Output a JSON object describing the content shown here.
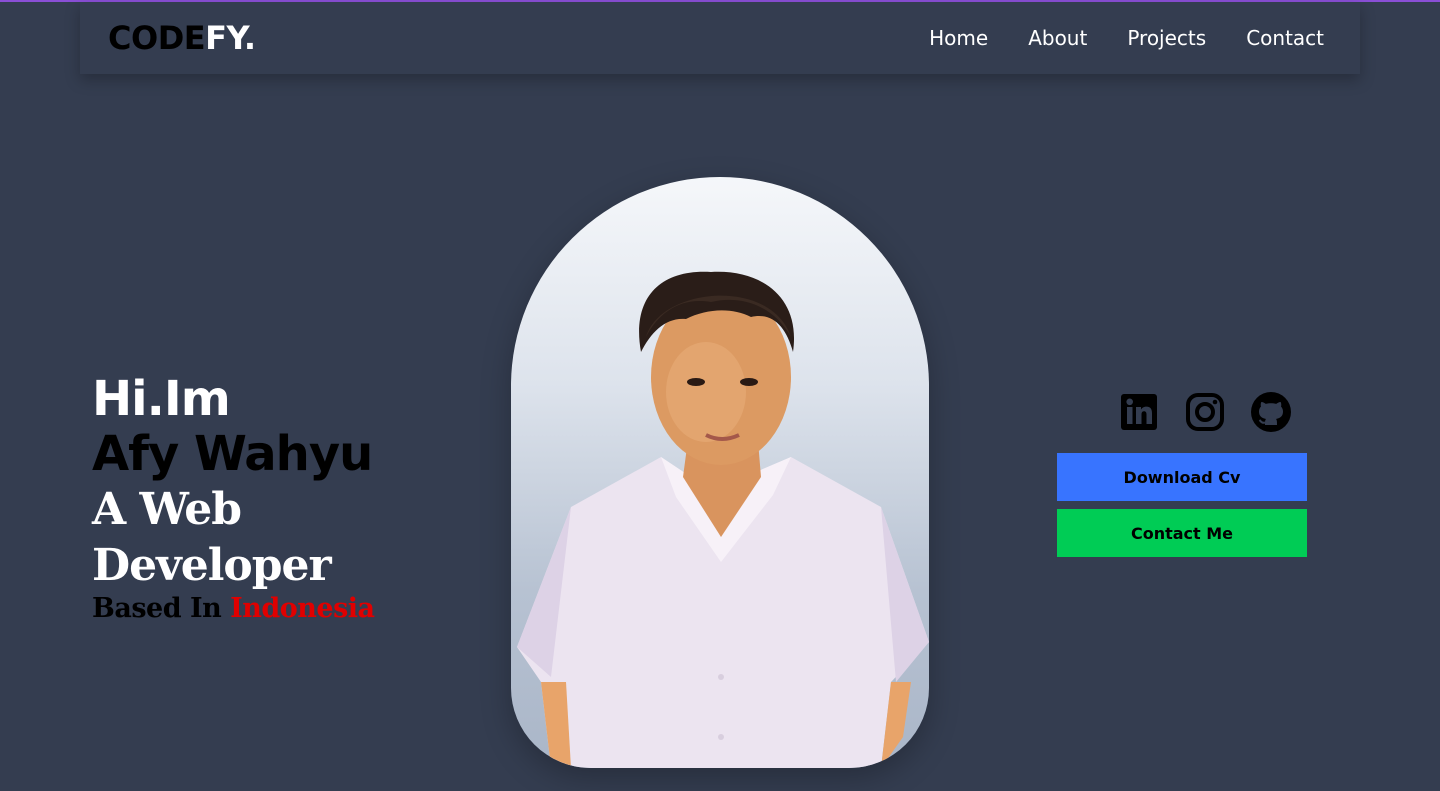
{
  "brand": {
    "logo_dark": "CODE",
    "logo_light": "FY."
  },
  "nav": {
    "items": [
      {
        "label": "Home"
      },
      {
        "label": "About"
      },
      {
        "label": "Projects"
      },
      {
        "label": "Contact"
      }
    ]
  },
  "hero": {
    "greeting": "Hi.Im",
    "name": "Afy Wahyu",
    "role": "A Web Developer",
    "based_prefix": "Based In",
    "based_country": "Indonesia"
  },
  "socials": [
    {
      "icon": "linkedin-icon"
    },
    {
      "icon": "instagram-icon"
    },
    {
      "icon": "github-icon"
    }
  ],
  "buttons": {
    "download_cv": "Download Cv",
    "contact_me": "Contact Me"
  },
  "colors": {
    "background": "#343d50",
    "accent_line": "#8a4fd6",
    "download_button": "#3874ff",
    "contact_button": "#00cc55",
    "country_highlight": "#e00000"
  }
}
